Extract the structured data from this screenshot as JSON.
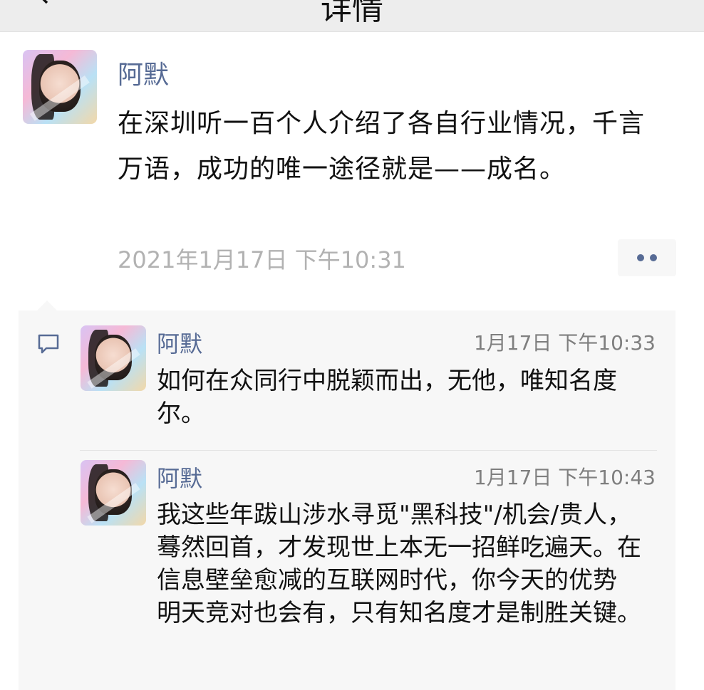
{
  "nav": {
    "back_icon": "chevron-left-icon",
    "title": "详情"
  },
  "post": {
    "author": "阿默",
    "text": "在深圳听一百个人介绍了各自行业情况，千言万语，成功的唯一途径就是——成名。",
    "time": "2021年1月17日 下午10:31",
    "more_icon": "more-dots-icon"
  },
  "comments": [
    {
      "author": "阿默",
      "time": "1月17日 下午10:33",
      "text": "如何在众同行中脱颖而出，无他，唯知名度尔。"
    },
    {
      "author": "阿默",
      "time": "1月17日 下午10:43",
      "text": "我这些年跋山涉水寻觅\"黑科技\"/机会/贵人，蓦然回首，才发现世上本无一招鲜吃遍天。在信息壁垒愈减的互联网时代，你今天的优势 明天竞对也会有，只有知名度才是制胜关键。"
    }
  ],
  "colors": {
    "link": "#576b95",
    "time_gray": "#b2b2b2",
    "comment_bg": "#f7f7f7"
  }
}
